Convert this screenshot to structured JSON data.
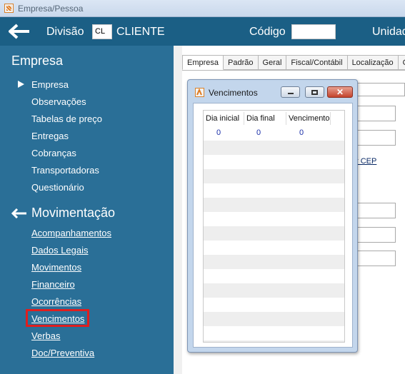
{
  "window": {
    "title": "Empresa/Pessoa"
  },
  "header": {
    "divisao_label": "Divisão",
    "divisao_code": "CL",
    "divisao_name": "CLIENTE",
    "codigo_label": "Código",
    "codigo_value": "",
    "unidade_label": "Unidad"
  },
  "sidebar": {
    "section_empresa": "Empresa",
    "empresa_items": [
      "Empresa",
      "Observações",
      "Tabelas de preço",
      "Entregas",
      "Cobranças",
      "Transportadoras",
      "Questionário"
    ],
    "section_movimentacao": "Movimentação",
    "movimentacao_items": [
      "Acompanhamentos",
      "Dados Legais",
      "Movimentos",
      "Financeiro",
      "Ocorrências",
      "Vencimentos",
      "Verbas",
      "Doc/Preventiva"
    ],
    "highlighted_item": "Vencimentos"
  },
  "tabs": [
    "Empresa",
    "Padrão",
    "Geral",
    "Fiscal/Contábil",
    "Localização",
    "Con"
  ],
  "cep_link": "r CEP",
  "dialog": {
    "title": "Vencimentos",
    "columns": [
      "Dia inicial",
      "Dia final",
      "Vencimento"
    ],
    "rows": [
      [
        "0",
        "0",
        "0"
      ]
    ]
  },
  "colors": {
    "header_bg": "#1b5f85",
    "sidebar_bg": "#2a6f97",
    "highlight_border": "#e01e1e",
    "dialog_frame": "#c3d6ec"
  }
}
